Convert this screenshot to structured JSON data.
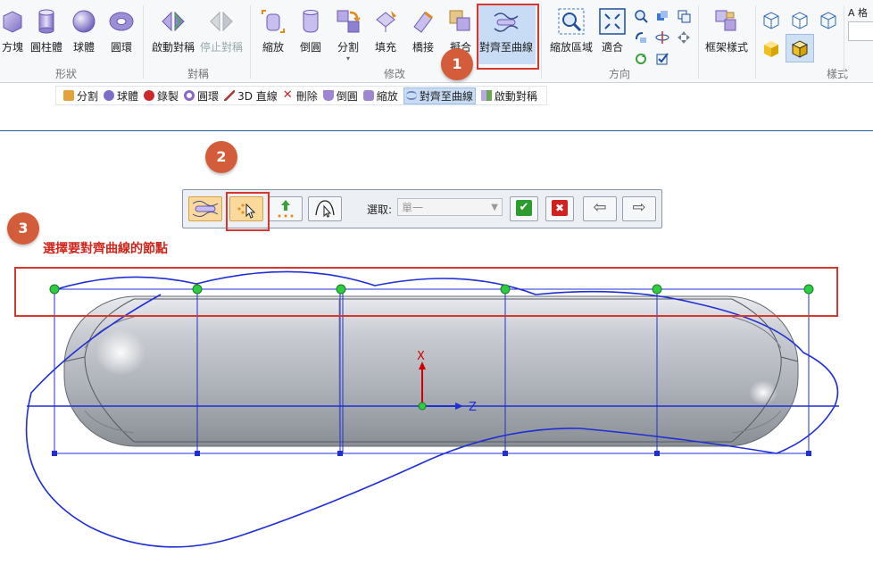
{
  "ribbon": {
    "buttons": [
      {
        "label": "方塊",
        "icon": "box-icon"
      },
      {
        "label": "圓柱體",
        "icon": "cylinder-icon"
      },
      {
        "label": "球體",
        "icon": "sphere-icon"
      },
      {
        "label": "圓環",
        "icon": "torus-icon"
      },
      {
        "label": "啟動對稱",
        "icon": "enable-symmetry-icon"
      },
      {
        "label": "停止對稱",
        "icon": "stop-symmetry-icon"
      },
      {
        "label": "縮放",
        "icon": "scale-icon"
      },
      {
        "label": "倒圓",
        "icon": "round-icon"
      },
      {
        "label": "分割",
        "icon": "split-icon"
      },
      {
        "label": "填充",
        "icon": "fill-icon"
      },
      {
        "label": "橋接",
        "icon": "bridge-icon"
      },
      {
        "label": "擬合",
        "icon": "fit-icon"
      },
      {
        "label": "對齊至曲線",
        "icon": "align-to-curve-icon"
      },
      {
        "label": "縮放區域",
        "icon": "zoom-area-icon"
      },
      {
        "label": "適合",
        "icon": "fit-view-icon"
      },
      {
        "label": "框架樣式",
        "icon": "frame-style-icon"
      }
    ],
    "groups": {
      "shape": "形狀",
      "symmetry": "對稱",
      "modify": "修改",
      "orient": "方向",
      "style": "樣式"
    },
    "split_dropdown": "▾",
    "top_right_label": "A 格"
  },
  "quickbar": {
    "items": [
      {
        "label": "分割",
        "color": "#e3a23a"
      },
      {
        "label": "球體",
        "color": "#7d6fc7"
      },
      {
        "label": "錄製",
        "color": "#cc2a2a"
      },
      {
        "label": "圓環",
        "color": "#8a67c8"
      },
      {
        "label": "3D 直線",
        "color": "#b0362e"
      },
      {
        "label": "刪除",
        "color": "#d02020"
      },
      {
        "label": "倒圓",
        "color": "#9f86d0"
      },
      {
        "label": "縮放",
        "color": "#9f86d0"
      },
      {
        "label": "對齊至曲線",
        "color": "#6f88b8",
        "active": true
      },
      {
        "label": "啟動對稱",
        "color": "#6aa84f"
      }
    ]
  },
  "badges": [
    "1",
    "2",
    "3"
  ],
  "instruction": "選擇要對齊曲線的節點",
  "command_bar": {
    "select_label": "選取:",
    "select_value": "單一",
    "ok_symbol": "✔",
    "cancel_symbol": "✖",
    "prev_symbol": "⇦",
    "next_symbol": "⇨"
  },
  "triad": {
    "x_label": "X",
    "z_label": "Z"
  },
  "colors": {
    "accent_blue": "#1f2fd6",
    "highlight_red": "#d9372e",
    "badge_orange": "#d35c3b",
    "node_green": "#2ecc40"
  }
}
